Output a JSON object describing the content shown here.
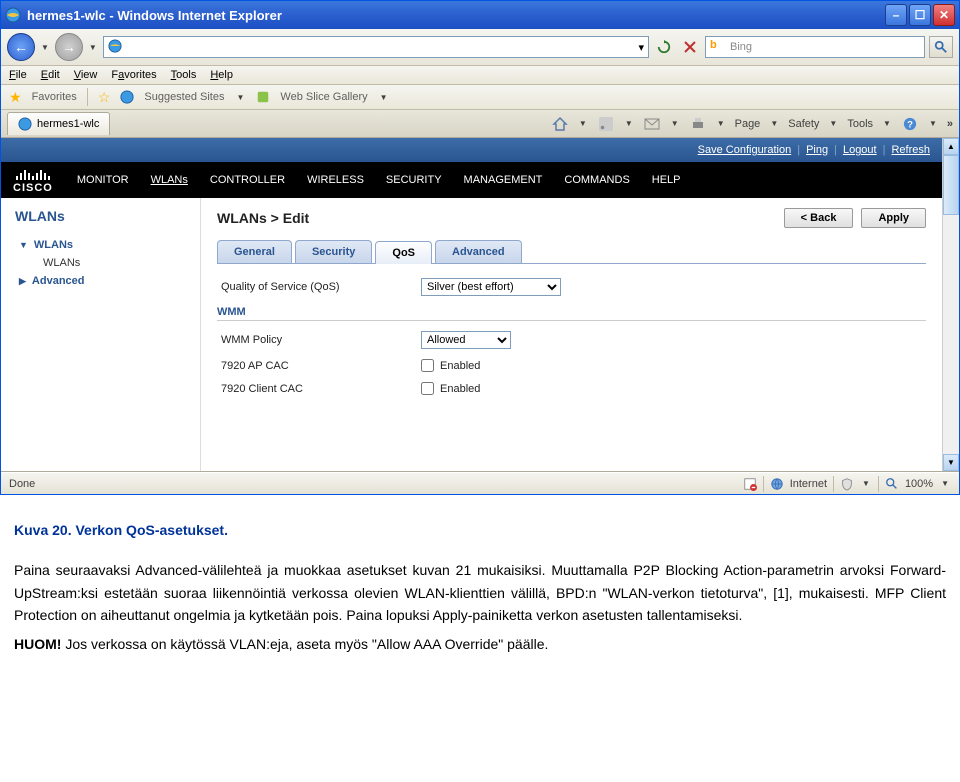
{
  "window": {
    "title": "hermes1-wlc - Windows Internet Explorer"
  },
  "address": {
    "value": ""
  },
  "search": {
    "placeholder": "Bing"
  },
  "menubar": {
    "file": "File",
    "edit": "Edit",
    "view": "View",
    "favorites": "Favorites",
    "tools": "Tools",
    "help": "Help"
  },
  "favbar": {
    "favorites": "Favorites",
    "suggested": "Suggested Sites",
    "webslice": "Web Slice Gallery"
  },
  "tab": {
    "label": "hermes1-wlc"
  },
  "ietools": {
    "page": "Page",
    "safety": "Safety",
    "tools": "Tools",
    "more": "»"
  },
  "cisco": {
    "toplinks": {
      "save": "Save Configuration",
      "ping": "Ping",
      "logout": "Logout",
      "refresh": "Refresh"
    },
    "logo": "CISCO",
    "nav": {
      "monitor": "MONITOR",
      "wlans": "WLANs",
      "controller": "CONTROLLER",
      "wireless": "WIRELESS",
      "security": "SECURITY",
      "management": "MANAGEMENT",
      "commands": "COMMANDS",
      "help": "HELP"
    },
    "sidebar": {
      "heading": "WLANs",
      "items": [
        {
          "label": "WLANs",
          "type": "parent"
        },
        {
          "label": "WLANs",
          "type": "sub"
        },
        {
          "label": "Advanced",
          "type": "collapsed"
        }
      ]
    },
    "main": {
      "heading": "WLANs > Edit",
      "back": "< Back",
      "apply": "Apply",
      "tabs": {
        "general": "General",
        "security": "Security",
        "qos": "QoS",
        "advanced": "Advanced"
      },
      "qos_label": "Quality of Service (QoS)",
      "qos_value": "Silver (best effort)",
      "wmm_heading": "WMM",
      "wmm_policy_label": "WMM Policy",
      "wmm_policy_value": "Allowed",
      "ap_cac_label": "7920 AP CAC",
      "client_cac_label": "7920 Client CAC",
      "enabled": "Enabled"
    }
  },
  "statusbar": {
    "done": "Done",
    "zone": "Internet",
    "zoom": "100%"
  },
  "doc": {
    "caption": "Kuva 20. Verkon QoS-asetukset.",
    "p1a": "Paina seuraavaksi Advanced-välilehteä ja muokkaa asetukset kuvan 21 mukaisiksi. Muuttamalla P2P Blocking Action-parametrin arvoksi Forward-UpStream:ksi estetään suoraa liikennöintiä verkossa olevien WLAN-klienttien välillä, BPD:n \"WLAN-verkon tietoturva\", [1], mukaisesti.  MFP Client Protection on aiheuttanut ongelmia ja kytketään pois. Paina lopuksi Apply-painiketta verkon asetusten tallentamiseksi.",
    "huom": "HUOM!",
    "p2": " Jos verkossa on käytössä VLAN:eja, aseta myös \"Allow AAA Override\" päälle."
  }
}
